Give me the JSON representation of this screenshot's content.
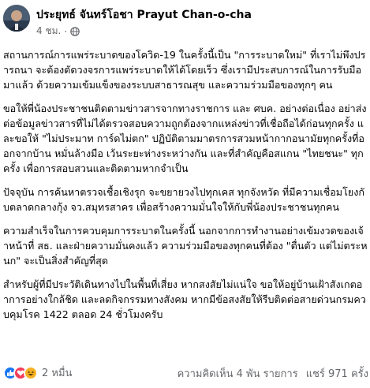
{
  "author": {
    "name": "ประยุทธ์ จันทร์โอชา Prayut Chan-o-cha",
    "time": "4 ชม.",
    "separator": "·"
  },
  "post": {
    "paragraphs": [
      "สถานการณ์การแพร่ระบาดของโควิด-19 ในครั้งนี้เป็น \"การระบาดใหม่\" ที่เราไม่พึงปรารถนา จะต้องตัดวงจรการแพร่ระบาดให้ได้โดยเร็ว ซึ่งเรามีประสบการณ์ในการรับมือมาแล้ว ด้วยความเข้มแข็งของระบบสาธารณสุข และความร่วมมือของทุกๆ คน",
      "ขอให้พี่น้องประชาชนติดตามข่าวสารจากทางราชการ และ ศบค. อย่างต่อเนื่อง อย่าส่งต่อข้อมูลข่าวสารที่ไม่ได้ตรวจสอบความถูกต้องจากแหล่งข่าวที่เชื่อถือได้ก่อนทุกครั้ง และขอให้ \"ไม่ประมาท การ์ดไม่ตก\" ปฏิบัติตามมาตรการสวมหน้ากากอนามัยทุกครั้งที่ออกจากบ้าน หมั่นล้างมือ เว้นระยะห่างระหว่างกัน และที่สำคัญคือสแกน \"ไทยชนะ\" ทุกครั้ง เพื่อการสอบสวนและติดตามหากจำเป็น",
      "ปัจจุบัน การค้นหาตรวจเชื้อเชิงรุก จะขยายวงไปทุกเคส ทุกจังหวัด ที่มีความเชื่อมโยงกับตลาดกลางกุ้ง จว.สมุทรสาคร เพื่อสร้างความมั่นใจให้กับพี่น้องประชาชนทุกคน",
      "ความสำเร็จในการควบคุมการระบาดในครั้งนี้ นอกจากการทำงานอย่างเข้มงวดของเจ้าหน้าที่ สธ. และฝ่ายความมั่นคงแล้ว ความร่วมมือของทุกคนที่ต้อง \"ตื่นตัว แต่ไม่ตระหนก\" จะเป็นสิ่งสำคัญที่สุด",
      "สำหรับผู้ที่มีประวัติเดินทางไปในพื้นที่เสี่ยง หากสงสัยไม่แน่ใจ ขอให้อยู่บ้านเฝ้าสังเกตอาการอย่างใกล้ชิด และลดกิจกรรมทางสังคม หากมีข้อสงสัยให้รีบติดต่อสายด่วนกรมควบคุมโรค 1422 ตลอด 24 ชั่วโมงครับ"
    ]
  },
  "footer": {
    "reaction_count": "2 หมื่น",
    "comments": "ความคิดเห็น 4 พัน รายการ",
    "shares": "แชร์ 971 ครั้ง"
  },
  "colors": {
    "like": "#1877f2",
    "love": "#f33e58",
    "haha": "#f7b125",
    "secondary_text": "#65676b"
  },
  "icons": {
    "privacy": "globe-icon",
    "reactions": [
      "like-icon",
      "love-icon",
      "haha-icon"
    ]
  }
}
